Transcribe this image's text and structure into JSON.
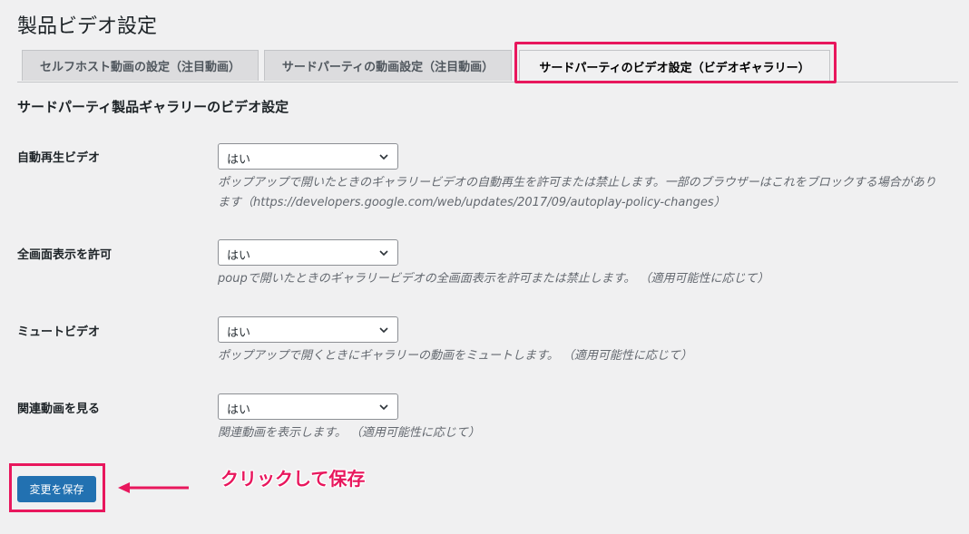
{
  "page": {
    "title": "製品ビデオ設定"
  },
  "tabs": [
    {
      "label": "セルフホスト動画の設定（注目動画）"
    },
    {
      "label": "サードパーティの動画設定（注目動画）"
    },
    {
      "label": "サードパーティのビデオ設定（ビデオギャラリー）",
      "active": true
    }
  ],
  "section": {
    "heading": "サードパーティ製品ギャラリーのビデオ設定"
  },
  "settings": [
    {
      "label": "自動再生ビデオ",
      "value": "はい",
      "description": "ポップアップで開いたときのギャラリービデオの自動再生を許可または禁止します。一部のブラウザーはこれをブロックする場合があります（https://developers.google.com/web/updates/2017/09/autoplay-policy-changes）"
    },
    {
      "label": "全画面表示を許可",
      "value": "はい",
      "description": "poupで開いたときのギャラリービデオの全画面表示を許可または禁止します。 （適用可能性に応じて）"
    },
    {
      "label": "ミュートビデオ",
      "value": "はい",
      "description": "ポップアップで開くときにギャラリーの動画をミュートします。 （適用可能性に応じて）"
    },
    {
      "label": "関連動画を見る",
      "value": "はい",
      "description": "関連動画を表示します。 （適用可能性に応じて）"
    }
  ],
  "save": {
    "label": "変更を保存"
  },
  "annotation": {
    "text": "クリックして保存"
  },
  "colors": {
    "highlight": "#e8175d",
    "primary": "#2271b1",
    "background": "#f0f0f1"
  }
}
